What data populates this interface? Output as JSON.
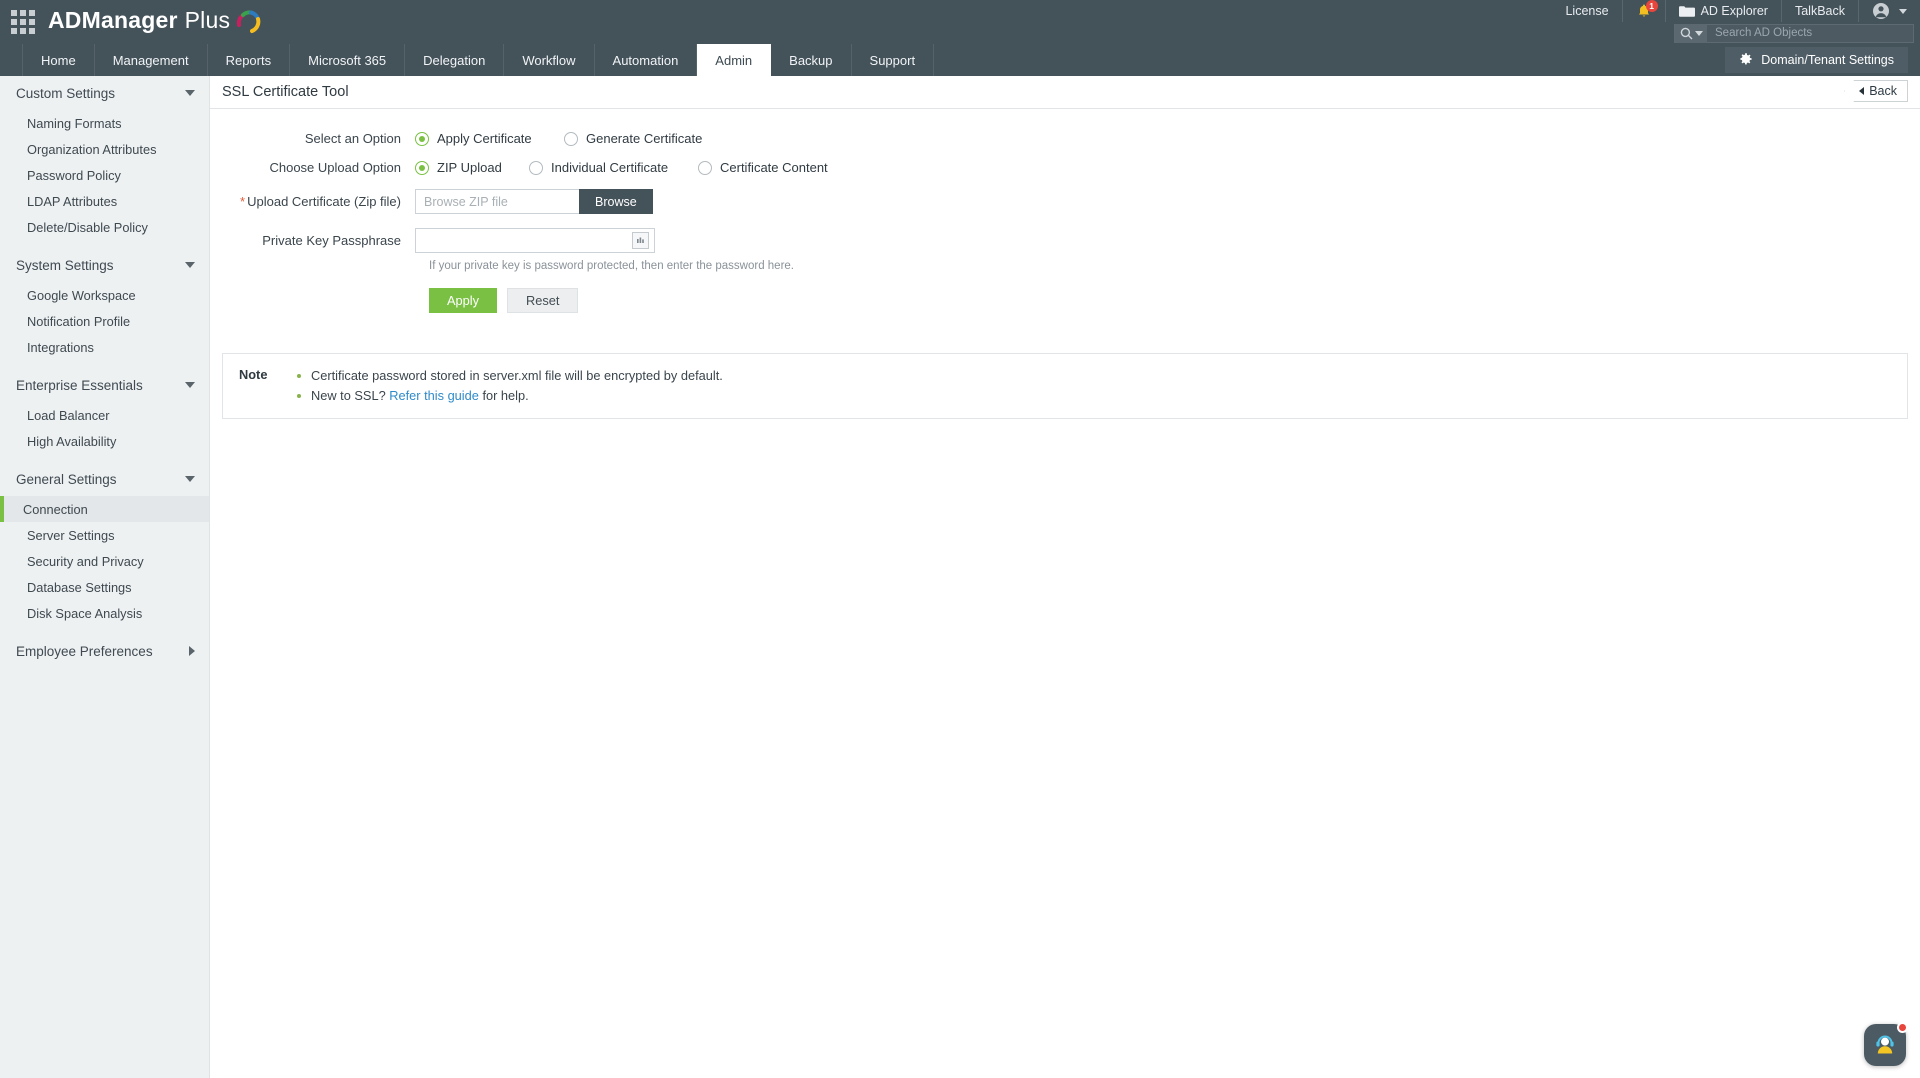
{
  "app": {
    "brand_bold": "ADManager",
    "brand_light": "Plus",
    "grid_icon": "apps-grid-icon"
  },
  "header": {
    "license_label": "License",
    "notifications": {
      "icon": "bell-icon",
      "badge": "1"
    },
    "ad_explorer_label": "AD Explorer",
    "talkback_label": "TalkBack",
    "account_icon": "user-account-icon",
    "search": {
      "placeholder": "Search AD Objects",
      "value": "",
      "icon": "search-icon"
    }
  },
  "nav": {
    "tabs": [
      {
        "label": "Home",
        "active": false
      },
      {
        "label": "Management",
        "active": false
      },
      {
        "label": "Reports",
        "active": false
      },
      {
        "label": "Microsoft 365",
        "active": false
      },
      {
        "label": "Delegation",
        "active": false
      },
      {
        "label": "Workflow",
        "active": false
      },
      {
        "label": "Automation",
        "active": false
      },
      {
        "label": "Admin",
        "active": true
      },
      {
        "label": "Backup",
        "active": false
      },
      {
        "label": "Support",
        "active": false
      }
    ],
    "domain_settings_label": "Domain/Tenant Settings",
    "domain_settings_icon": "gear-icon"
  },
  "sidebar": {
    "groups": [
      {
        "label": "Custom Settings",
        "expanded": true,
        "items": [
          "Naming Formats",
          "Organization Attributes",
          "Password Policy",
          "LDAP Attributes",
          "Delete/Disable Policy"
        ]
      },
      {
        "label": "System Settings",
        "expanded": true,
        "items": [
          "Google Workspace",
          "Notification Profile",
          "Integrations"
        ]
      },
      {
        "label": "Enterprise Essentials",
        "expanded": true,
        "items": [
          "Load Balancer",
          "High Availability"
        ]
      },
      {
        "label": "General Settings",
        "expanded": true,
        "items": [
          "Connection",
          "Server Settings",
          "Security and Privacy",
          "Database Settings",
          "Disk Space Analysis"
        ]
      },
      {
        "label": "Employee Preferences",
        "expanded": false,
        "items": []
      }
    ],
    "active_item": "Connection"
  },
  "page": {
    "title": "SSL Certificate Tool",
    "back_label": "Back"
  },
  "form": {
    "select_option": {
      "label": "Select an Option",
      "options": [
        {
          "label": "Apply Certificate",
          "selected": true
        },
        {
          "label": "Generate Certificate",
          "selected": false
        }
      ]
    },
    "upload_option": {
      "label": "Choose Upload Option",
      "options": [
        {
          "label": "ZIP Upload",
          "selected": true
        },
        {
          "label": "Individual Certificate",
          "selected": false
        },
        {
          "label": "Certificate Content",
          "selected": false
        }
      ]
    },
    "upload_certificate": {
      "label": "Upload Certificate (Zip file)",
      "required": true,
      "placeholder": "Browse ZIP file",
      "value": "",
      "browse_label": "Browse"
    },
    "passphrase": {
      "label": "Private Key Passphrase",
      "value": "",
      "placeholder": "",
      "toggle_icon": "password-mask-icon",
      "hint": "If your private key is password protected, then enter the password here."
    },
    "apply_label": "Apply",
    "reset_label": "Reset"
  },
  "note": {
    "title": "Note",
    "items": [
      {
        "pre": "Certificate password stored in server.xml file will be encrypted by default.",
        "link": "",
        "post": ""
      },
      {
        "pre": "New to SSL? ",
        "link": "Refer this guide",
        "post": " for help."
      }
    ]
  },
  "chat": {
    "icon": "support-agent-icon",
    "has_unread": true
  },
  "colors": {
    "header_bg": "#44525a",
    "accent_green": "#7ac143",
    "badge_red": "#e8453c",
    "link_blue": "#2f8bc9",
    "sidebar_bg": "#eef1f2"
  }
}
